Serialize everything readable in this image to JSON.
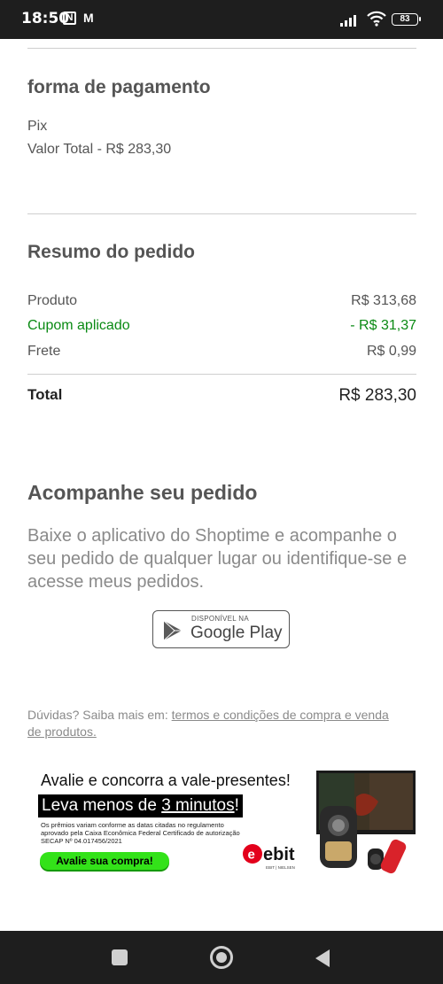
{
  "status_bar": {
    "time": "18:50",
    "nfc_icon": "N",
    "mail_icon": "M",
    "battery": "83"
  },
  "payment": {
    "title": "forma de pagamento",
    "method": "Pix",
    "total_line": "Valor Total - R$ 283,30"
  },
  "summary": {
    "title": "Resumo do pedido",
    "rows": [
      {
        "label": "Produto",
        "value": "R$ 313,68"
      },
      {
        "label": "Cupom aplicado",
        "value": "- R$ 31,37"
      },
      {
        "label": "Frete",
        "value": "R$ 0,99"
      }
    ],
    "total_label": "Total",
    "total_value": "R$ 283,30",
    "coupon_color": "#0a8a13"
  },
  "track": {
    "title": "Acompanhe seu pedido",
    "text": "Baixe o aplicativo do Shoptime e acompanhe o seu pedido de qualquer lugar ou identifique-se e acesse meus pedidos.",
    "badge_small": "DISPONÍVEL NA",
    "badge_big": "Google Play"
  },
  "help": {
    "prefix": "Dúvidas? Saiba mais em: ",
    "link": "termos e condições de compra e venda de produtos."
  },
  "banner": {
    "headline": "Avalie e concorra a vale-presentes!",
    "subline_prefix": "Leva menos de ",
    "subline_emph": "3 minutos",
    "subline_suffix": "!",
    "fine_print": "Os prêmios variam conforme as datas citadas no regulamento aprovado pela Caixa Econômica Federal Certificado de autorização SECAP Nº 04.017456/2021",
    "cta": "Avalie sua compra!",
    "brand": "ebit",
    "brand_sub": "EBIT | NIELSEN",
    "cta_color": "#33e219"
  },
  "nav": {
    "icons": [
      "recents-icon",
      "home-icon",
      "back-icon"
    ]
  }
}
